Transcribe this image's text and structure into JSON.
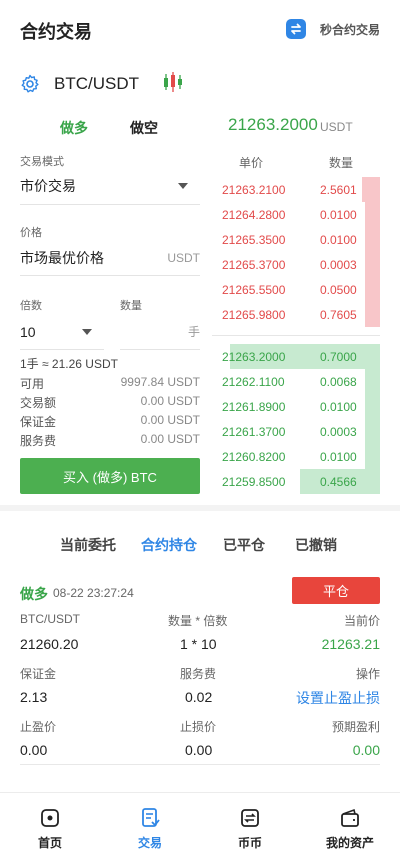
{
  "header": {
    "title": "合约交易",
    "swap_label": "秒合约交易"
  },
  "symbol": {
    "pair": "BTC/USDT"
  },
  "trade_tabs": {
    "long": "做多",
    "short": "做空"
  },
  "ticker": {
    "price": "21263.2000",
    "unit": "USDT"
  },
  "form": {
    "mode_label": "交易模式",
    "mode_value": "市价交易",
    "price_label": "价格",
    "price_value": "市场最优价格",
    "price_unit": "USDT",
    "leverage_label": "倍数",
    "leverage_value": "10",
    "qty_label": "数量",
    "qty_unit": "手",
    "lot_note": "1手 ≈ 21.26 USDT",
    "stats": [
      {
        "label": "可用",
        "value": "9997.84 USDT"
      },
      {
        "label": "交易额",
        "value": "0.00 USDT"
      },
      {
        "label": "保证金",
        "value": "0.00 USDT"
      },
      {
        "label": "服务费",
        "value": "0.00 USDT"
      }
    ],
    "buy_button": "买入 (做多) BTC"
  },
  "order_book": {
    "price_header": "单价",
    "qty_header": "数量",
    "asks": [
      {
        "price": "21263.2100",
        "qty": "2.5601",
        "depth": 0.12
      },
      {
        "price": "21264.2800",
        "qty": "0.0100",
        "depth": 0.1
      },
      {
        "price": "21265.3500",
        "qty": "0.0100",
        "depth": 0.1
      },
      {
        "price": "21265.3700",
        "qty": "0.0003",
        "depth": 0.1
      },
      {
        "price": "21265.5500",
        "qty": "0.0500",
        "depth": 0.1
      },
      {
        "price": "21265.9800",
        "qty": "0.7605",
        "depth": 0.1
      }
    ],
    "bids": [
      {
        "price": "21263.2000",
        "qty": "0.7000",
        "depth": 1.0
      },
      {
        "price": "21262.1100",
        "qty": "0.0068",
        "depth": 0.1
      },
      {
        "price": "21261.8900",
        "qty": "0.0100",
        "depth": 0.1
      },
      {
        "price": "21261.3700",
        "qty": "0.0003",
        "depth": 0.1
      },
      {
        "price": "21260.8200",
        "qty": "0.0100",
        "depth": 0.1
      },
      {
        "price": "21259.8500",
        "qty": "0.4566",
        "depth": 0.53
      }
    ]
  },
  "position_tabs": [
    "当前委托",
    "合约持仓",
    "已平仓",
    "已撤销"
  ],
  "position": {
    "direction": "做多",
    "time": "08-22 23:27:24",
    "close_button": "平仓",
    "pair_label": "BTC/USDT",
    "qty_label": "数量 * 倍数",
    "current_price_label": "当前价",
    "open_price": "21260.20",
    "qty_value": "1 * 10",
    "current_price": "21263.21",
    "margin_label": "保证金",
    "fee_label": "服务费",
    "action_label": "操作",
    "margin_value": "2.13",
    "fee_value": "0.02",
    "action_link": "设置止盈止损",
    "tp_label": "止盈价",
    "sl_label": "止损价",
    "pnl_label": "预期盈利",
    "tp_value": "0.00",
    "sl_value": "0.00",
    "pnl_value": "0.00"
  },
  "bottom_nav": [
    {
      "label": "首页",
      "icon": "home-icon"
    },
    {
      "label": "交易",
      "icon": "trade-icon"
    },
    {
      "label": "币币",
      "icon": "exchange-icon"
    },
    {
      "label": "我的资产",
      "icon": "wallet-icon"
    }
  ],
  "colors": {
    "green": "#3aa54a",
    "red": "#e24a4a",
    "blue": "#2f86e5",
    "sell_btn": "#e8453c"
  }
}
